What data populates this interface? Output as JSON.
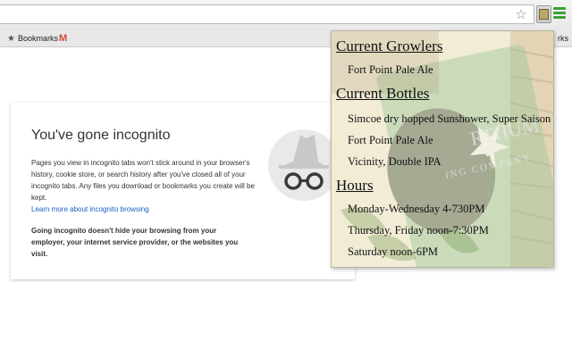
{
  "browser": {
    "bookmarks_label": "Bookmarks",
    "gmail_icon": "M",
    "right_bookmark_fragment": "rks",
    "icons": {
      "star": "star-icon",
      "extension": "beer-tap-icon",
      "menu": "menu-icon"
    }
  },
  "incognito": {
    "title": "You've gone incognito",
    "body": "Pages you view in incognito tabs won't stick around in your browser's history, cookie store, or search history after you've closed all of your incognito tabs. Any files you download or bookmarks you create will be kept.",
    "learn_more": "Learn more about incognito browsing",
    "warning": "Going incognito doesn't hide your browsing from your employer, your internet service provider, or the websites you visit."
  },
  "popup": {
    "logo_text_top": "RTHUM",
    "logo_text_bottom": "ING COMPANY",
    "growlers_heading": "Current Growlers",
    "growlers": [
      "Fort Point Pale Ale"
    ],
    "bottles_heading": "Current Bottles",
    "bottles": [
      "Simcoe dry hopped Sunshower, Super Saison",
      "Fort Point Pale Ale",
      "Vicinity, Double IPA"
    ],
    "hours_heading": "Hours",
    "hours": [
      "Monday-Wednesday 4-730PM",
      "Thursday, Friday noon-7:30PM",
      "Saturday noon-6PM"
    ]
  },
  "colors": {
    "link": "#1a5dc8",
    "menu_green": "#3e9f3a",
    "popup_bg": "#f3eed9",
    "label_green": "#9ec79a"
  }
}
